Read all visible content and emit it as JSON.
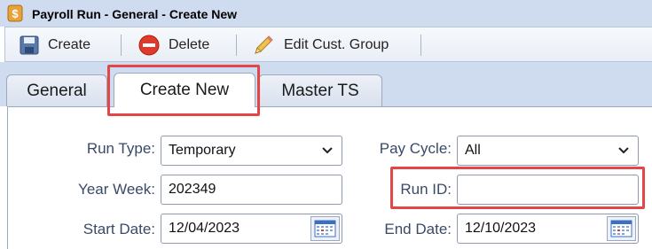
{
  "window": {
    "title": "Payroll Run - General - Create New",
    "app_icon": "dollar-app-icon"
  },
  "toolbar": {
    "create_label": "Create",
    "delete_label": "Delete",
    "edit_group_label": "Edit Cust. Group"
  },
  "tabs": [
    {
      "label": "General",
      "active": false
    },
    {
      "label": "Create New",
      "active": true
    },
    {
      "label": "Master TS",
      "active": false
    }
  ],
  "form": {
    "run_type": {
      "label": "Run Type:",
      "value": "Temporary"
    },
    "pay_cycle": {
      "label": "Pay Cycle:",
      "value": "All"
    },
    "year_week": {
      "label": "Year Week:",
      "value": "202349"
    },
    "run_id": {
      "label": "Run ID:",
      "value": ""
    },
    "start_date": {
      "label": "Start Date:",
      "value": "12/04/2023"
    },
    "end_date": {
      "label": "End Date:",
      "value": "12/10/2023"
    }
  },
  "colors": {
    "highlight": "#e34646",
    "header_bg": "#cfdcf0",
    "label_text": "#3a4a66"
  }
}
